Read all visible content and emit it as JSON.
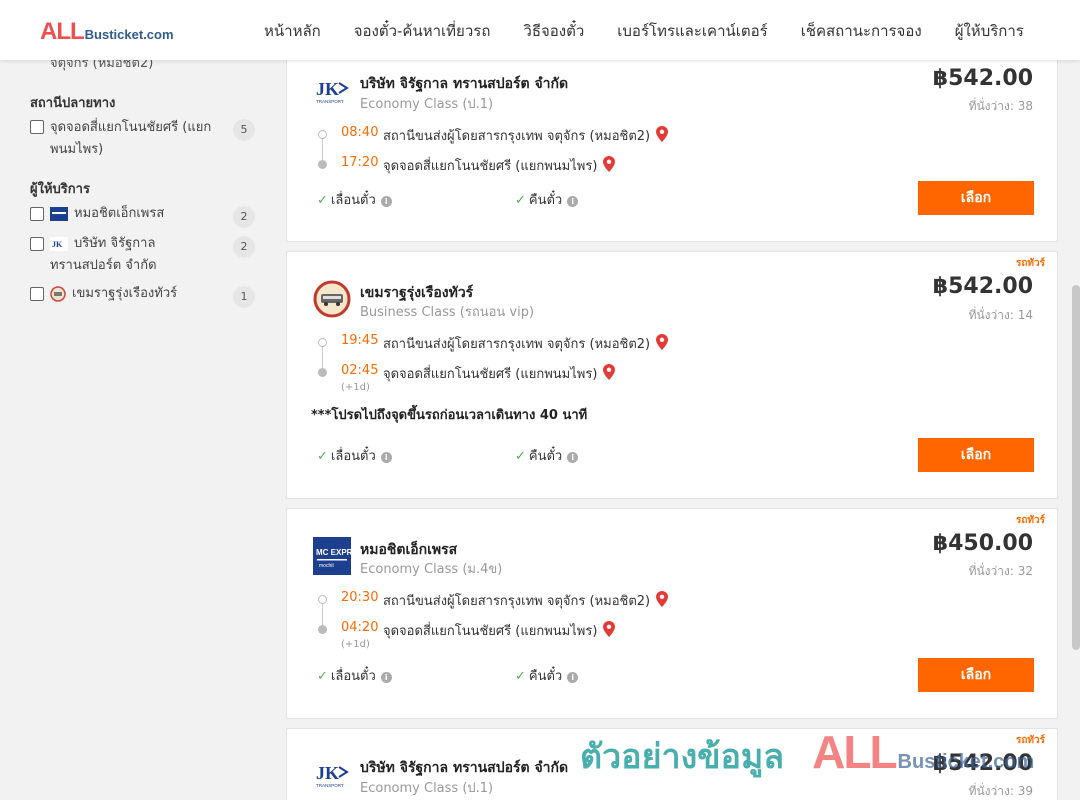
{
  "logo": {
    "all": "ALL",
    "rest": "Busticket.com"
  },
  "nav": [
    "หน้าหลัก",
    "จองตั๋ว-ค้นหาเที่ยวรถ",
    "วิธีจองตั๋ว",
    "เบอร์โทรและเคาน์เตอร์",
    "เช็คสถานะการจอง",
    "ผู้ให้บริการ"
  ],
  "sidebar": {
    "cut_text": "จตุจักร (หมอชิต2)",
    "destination_title": "สถานีปลายทาง",
    "destinations": [
      {
        "label": "จุดจอดสี่แยกโนนชัยศรี (แยกพนมไพร)",
        "count": "5"
      }
    ],
    "operator_title": "ผู้ให้บริการ",
    "operators": [
      {
        "label": "หมอชิตเอ็กเพรส",
        "count": "2",
        "logo": "mc-express-logo"
      },
      {
        "label": "บริษัท จิรัฐกาล ทรานสปอร์ต จำกัด",
        "count": "2",
        "logo": "jk-transport-logo"
      },
      {
        "label": "เขมราฐรุ่งเรืองทัวร์",
        "count": "1",
        "logo": "khemarat-logo"
      }
    ]
  },
  "cards": [
    {
      "operator": "บริษัท จิรัฐกาล ทรานสปอร์ต จำกัด",
      "class": "Economy Class (ป.1)",
      "price": "฿542.00",
      "seats": "ที่นั่งว่าง: 38",
      "tag": "",
      "depart_time": "08:40",
      "depart_stop": "สถานีขนส่งผู้โดยสารกรุงเทพ จตุจักร (หมอชิต2)",
      "arrive_time": "17:20",
      "arrive_stop": "จุดจอดสี่แยกโนนชัยศรี (แยกพนมไพร)",
      "next_day": "",
      "note": "",
      "feature1": "เลื่อนตั๋ว",
      "feature2": "คืนตั๋ว",
      "button": "เลือก"
    },
    {
      "operator": "เขมราฐรุ่งเรืองทัวร์",
      "class": "Business Class (รถนอน vip)",
      "price": "฿542.00",
      "seats": "ที่นั่งว่าง: 14",
      "tag": "รถทัวร์",
      "depart_time": "19:45",
      "depart_stop": "สถานีขนส่งผู้โดยสารกรุงเทพ จตุจักร (หมอชิต2)",
      "arrive_time": "02:45",
      "arrive_stop": "จุดจอดสี่แยกโนนชัยศรี (แยกพนมไพร)",
      "next_day": "(+1d)",
      "note": "***โปรดไปถึงจุดขึ้นรถก่อนเวลาเดินทาง 40 นาที",
      "feature1": "เลื่อนตั๋ว",
      "feature2": "คืนตั๋ว",
      "button": "เลือก"
    },
    {
      "operator": "หมอชิตเอ็กเพรส",
      "class": "Economy Class (ม.4ข)",
      "price": "฿450.00",
      "seats": "ที่นั่งว่าง: 32",
      "tag": "รถทัวร์",
      "depart_time": "20:30",
      "depart_stop": "สถานีขนส่งผู้โดยสารกรุงเทพ จตุจักร (หมอชิต2)",
      "arrive_time": "04:20",
      "arrive_stop": "จุดจอดสี่แยกโนนชัยศรี (แยกพนมไพร)",
      "next_day": "(+1d)",
      "note": "",
      "feature1": "เลื่อนตั๋ว",
      "feature2": "คืนตั๋ว",
      "button": "เลือก"
    },
    {
      "operator": "บริษัท จิรัฐกาล ทรานสปอร์ต จำกัด",
      "class": "Economy Class (ป.1)",
      "price": "฿542.00",
      "seats": "ที่นั่งว่าง: 39",
      "tag": "รถทัวร์"
    }
  ],
  "watermark": {
    "text": "ตัวอย่างข้อมูล",
    "all": "ALL",
    "rest": "Busticket.com"
  },
  "colors": {
    "accent": "#ff6600",
    "time": "#ff6b00",
    "pin": "#e53935",
    "check": "#4caf50",
    "logo_red": "#f04e4e",
    "logo_blue": "#2f5b8f"
  }
}
